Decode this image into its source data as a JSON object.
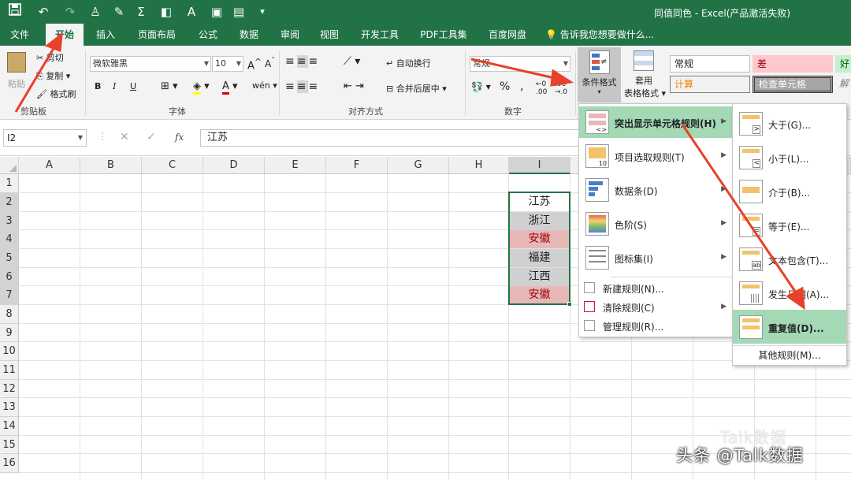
{
  "titlebar": {
    "title": "同值同色 - Excel(产品激活失败)",
    "qat_icons": [
      "save-icon",
      "undo-icon",
      "redo-icon",
      "person-icon",
      "brush-icon",
      "sigma-icon",
      "fill-icon",
      "font-color-icon",
      "picture-icon",
      "chart-icon",
      "customize-icon"
    ]
  },
  "tabs": [
    "文件",
    "开始",
    "插入",
    "页面布局",
    "公式",
    "数据",
    "审阅",
    "视图",
    "开发工具",
    "PDF工具集",
    "百度网盘"
  ],
  "tell_me": "告诉我您想要做什么...",
  "clipboard": {
    "paste": "粘贴",
    "cut": "剪切",
    "copy": "复制",
    "format_painter": "格式刷",
    "group": "剪贴板"
  },
  "font": {
    "name": "微软雅黑",
    "size": "10",
    "group": "字体",
    "bold": "B",
    "italic": "I",
    "underline": "U",
    "increase": "A",
    "decrease": "A",
    "font_color_label": "A"
  },
  "alignment": {
    "wrap": "自动换行",
    "merge": "合并后居中",
    "group": "对齐方式"
  },
  "number": {
    "format": "常规",
    "group": "数字",
    "percent": "%",
    "comma": ","
  },
  "conditional": {
    "label": "条件格式"
  },
  "table_format": {
    "label1": "套用",
    "label2": "表格格式"
  },
  "styles": {
    "normal": "常规",
    "bad": "差",
    "good": "好",
    "calc": "计算",
    "check": "检查单元格",
    "explain": "解"
  },
  "formula_bar": {
    "namebox": "I2",
    "fx": "fx",
    "value": "江苏"
  },
  "columns": [
    "A",
    "B",
    "C",
    "D",
    "E",
    "F",
    "G",
    "H",
    "I"
  ],
  "rows": [
    "1",
    "2",
    "3",
    "4",
    "5",
    "6",
    "7",
    "8",
    "9",
    "10",
    "11",
    "12",
    "13",
    "14",
    "15",
    "16"
  ],
  "cells": [
    {
      "value": "江苏",
      "style": "none"
    },
    {
      "value": "浙江",
      "style": "gray"
    },
    {
      "value": "安徽",
      "style": "pink"
    },
    {
      "value": "福建",
      "style": "gray"
    },
    {
      "value": "江西",
      "style": "gray"
    },
    {
      "value": "安徽",
      "style": "pink"
    }
  ],
  "menu": {
    "items": [
      {
        "label": "突出显示单元格规则(H)",
        "highlight": true
      },
      {
        "label": "项目选取规则(T)"
      },
      {
        "label": "数据条(D)"
      },
      {
        "label": "色阶(S)"
      },
      {
        "label": "图标集(I)"
      }
    ],
    "small_items": [
      {
        "label": "新建规则(N)..."
      },
      {
        "label": "清除规则(C)"
      },
      {
        "label": "管理规则(R)..."
      }
    ]
  },
  "submenu": {
    "items": [
      {
        "label": "大于(G)..."
      },
      {
        "label": "小于(L)..."
      },
      {
        "label": "介于(B)..."
      },
      {
        "label": "等于(E)..."
      },
      {
        "label": "文本包含(T)..."
      },
      {
        "label": "发生日期(A)..."
      },
      {
        "label": "重复值(D)...",
        "highlight": true
      }
    ],
    "more": "其他规则(M)..."
  },
  "watermark": {
    "text": "头条 @Talk数据",
    "faint": "Talk数据"
  },
  "colors": {
    "excel_green": "#217346",
    "menu_highlight": "#a3d9b5",
    "dup_fill": "#e6b8b7",
    "dup_text": "#9c0006",
    "gray_fill": "#d0d0d0",
    "arrow": "#e8402a"
  }
}
